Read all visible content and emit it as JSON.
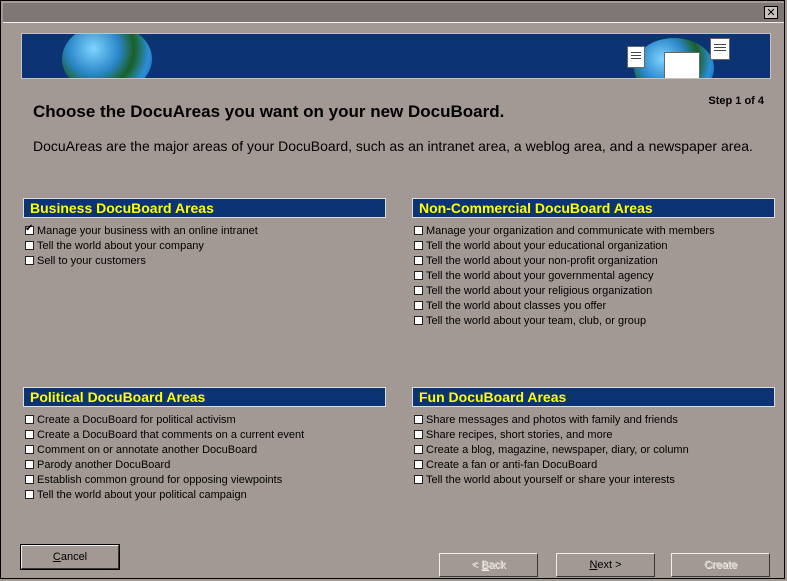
{
  "window": {
    "close_glyph": "✕"
  },
  "banner": {
    "icons": [
      "globe-icon",
      "document-icon"
    ]
  },
  "heading": "Choose the DocuAreas you want on your new DocuBoard.",
  "step": "Step 1 of 4",
  "intro": "DocuAreas are the major areas of your DocuBoard, such as an intranet area, a weblog area, and a newspaper area.",
  "groups": {
    "business": {
      "title": "Business DocuBoard Areas",
      "options": [
        {
          "label": "Manage your business with an online intranet",
          "checked": true
        },
        {
          "label": "Tell the world about your company",
          "checked": false
        },
        {
          "label": "Sell to your customers",
          "checked": false
        }
      ]
    },
    "noncommercial": {
      "title": "Non-Commercial DocuBoard Areas",
      "options": [
        {
          "label": "Manage your organization and communicate with members",
          "checked": false
        },
        {
          "label": "Tell the world about your educational organization",
          "checked": false
        },
        {
          "label": "Tell the world about your non-profit organization",
          "checked": false
        },
        {
          "label": "Tell the world about your governmental agency",
          "checked": false
        },
        {
          "label": "Tell the world about your religious organization",
          "checked": false
        },
        {
          "label": "Tell the world about classes you offer",
          "checked": false
        },
        {
          "label": "Tell the world about your team, club, or group",
          "checked": false
        }
      ]
    },
    "political": {
      "title": "Political DocuBoard Areas",
      "options": [
        {
          "label": "Create a DocuBoard for political activism",
          "checked": false
        },
        {
          "label": "Create a DocuBoard that comments on a current event",
          "checked": false
        },
        {
          "label": "Comment on or annotate another DocuBoard",
          "checked": false
        },
        {
          "label": "Parody another DocuBoard",
          "checked": false
        },
        {
          "label": "Establish common ground for opposing viewpoints",
          "checked": false
        },
        {
          "label": "Tell the world about your political campaign",
          "checked": false
        }
      ]
    },
    "fun": {
      "title": "Fun DocuBoard Areas",
      "options": [
        {
          "label": "Share messages and photos with family and friends",
          "checked": false
        },
        {
          "label": "Share recipes, short stories, and more",
          "checked": false
        },
        {
          "label": "Create a blog, magazine, newspaper, diary, or column",
          "checked": false
        },
        {
          "label": "Create a fan or anti-fan DocuBoard",
          "checked": false
        },
        {
          "label": "Tell the world about yourself or share your interests",
          "checked": false
        }
      ]
    }
  },
  "buttons": {
    "cancel": {
      "mnemonic": "C",
      "rest": "ancel"
    },
    "back": {
      "prefix": "< ",
      "mnemonic": "B",
      "rest": "ack"
    },
    "next": {
      "mnemonic": "N",
      "rest": "ext >"
    },
    "create": "Create"
  }
}
